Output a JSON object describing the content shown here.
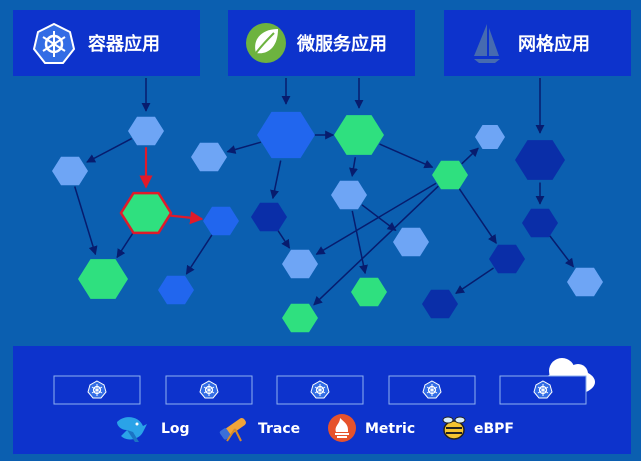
{
  "header": {
    "boxes": [
      {
        "label": "容器应用",
        "icon": "kubernetes-icon"
      },
      {
        "label": "微服务应用",
        "icon": "spring-leaf-icon"
      },
      {
        "label": "网格应用",
        "icon": "istio-sail-icon"
      }
    ]
  },
  "graph": {
    "colors": {
      "light": "#6ea5f5",
      "green": "#2fe07f",
      "mid": "#2166ee",
      "dark": "#0a2ea8",
      "highlight": "#e01a2a",
      "edge": "#071c6e"
    }
  },
  "cluster": {
    "node_count": 5,
    "node_icon": "kubernetes-icon",
    "cloud_icon": "cloud-icon"
  },
  "legend": [
    {
      "label": "Log",
      "icon": "bird-icon"
    },
    {
      "label": "Trace",
      "icon": "telescope-icon"
    },
    {
      "label": "Metric",
      "icon": "prometheus-flame-icon"
    },
    {
      "label": "eBPF",
      "icon": "bee-icon"
    }
  ]
}
